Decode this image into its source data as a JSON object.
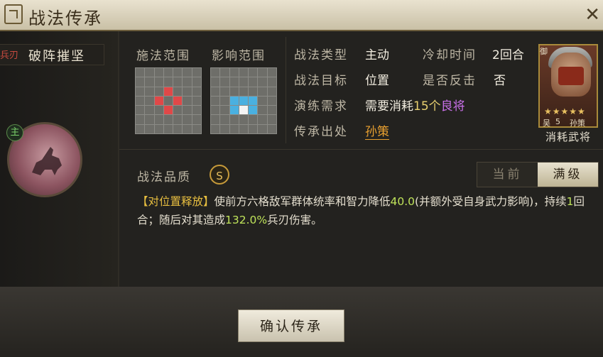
{
  "window": {
    "title": "战法传承"
  },
  "skill": {
    "type": "兵刃",
    "name": "破阵摧坚"
  },
  "master_badge": "主",
  "left_info": {
    "cast_range_label": "施法范围",
    "effect_range_label": "影响范围"
  },
  "props": {
    "type_label": "战法类型",
    "type_value": "主动",
    "cooldown_label": "冷却时间",
    "cooldown_value": "2回合",
    "target_label": "战法目标",
    "target_value": "位置",
    "counter_label": "是否反击",
    "counter_value": "否",
    "drill_label": "演练需求",
    "drill_value_prefix": "需要消耗",
    "drill_count": "15个",
    "drill_item": "良将",
    "source_label": "传承出处",
    "source_value": "孙策"
  },
  "quality": {
    "label": "战法品质",
    "grade": "S"
  },
  "tabs": {
    "current": "当前",
    "max": "满级"
  },
  "description": {
    "lead": "【对位置释放】",
    "part1": "使前方六格敌军群体统率和智力降低",
    "num1": "40.0",
    "part2": "(并额外受自身武力影响)，持续",
    "num2": "1",
    "part3": "回合；随后对其造成",
    "num3": "132.0%",
    "part4": "兵刃伤害。"
  },
  "general_card": {
    "camp": "吴",
    "level": "5",
    "name": "孙策",
    "stars": "★★★★★",
    "corner_tag": "御"
  },
  "consume_label": "消耗武将",
  "confirm_button": "确认传承",
  "colors": {
    "accent_gold": "#e8bf40",
    "highlight_green": "#bfe35a",
    "danger_red": "#c94a3f",
    "range_blue": "#4ab0e0"
  }
}
